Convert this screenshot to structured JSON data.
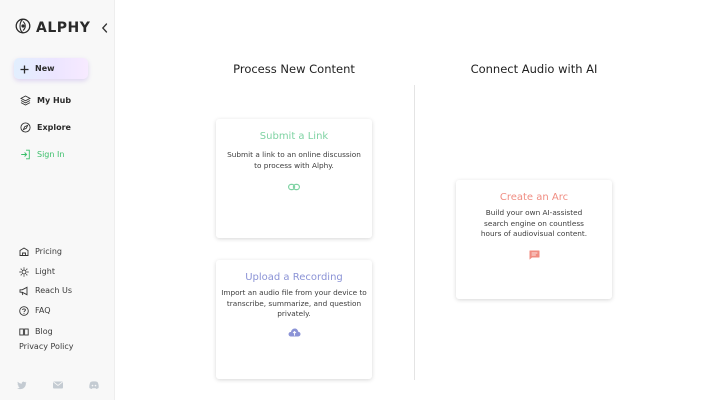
{
  "brand": {
    "name": "ALPHY"
  },
  "sidebar": {
    "new_label": "New",
    "nav": [
      {
        "label": "My Hub",
        "icon": "layers-icon"
      },
      {
        "label": "Explore",
        "icon": "compass-icon"
      },
      {
        "label": "Sign In",
        "icon": "sign-in-icon"
      }
    ],
    "bottom": [
      {
        "label": "Pricing",
        "icon": "pricing-icon"
      },
      {
        "label": "Light",
        "icon": "sun-icon"
      },
      {
        "label": "Reach Us",
        "icon": "megaphone-icon"
      },
      {
        "label": "FAQ",
        "icon": "help-icon"
      },
      {
        "label": "Blog",
        "icon": "blog-icon"
      }
    ],
    "privacy": "Privacy Policy",
    "socials": [
      "twitter-icon",
      "mail-icon",
      "discord-icon"
    ]
  },
  "main": {
    "process_title": "Process New Content",
    "connect_title": "Connect Audio with AI",
    "cards": {
      "link": {
        "title": "Submit a Link",
        "desc": "Submit a link to an online discussion to process with Alphy.",
        "icon": "link-icon"
      },
      "upload": {
        "title": "Upload a Recording",
        "desc": "Import an audio file from your device to transcribe, summarize, and question privately.",
        "icon": "cloud-upload-icon"
      },
      "arc": {
        "title": "Create an Arc",
        "desc": "Build your own AI-assisted search engine on countless hours of audiovisual content.",
        "icon": "chat-icon"
      }
    }
  },
  "colors": {
    "link_accent": "#7fd3a3",
    "upload_accent": "#8b93d6",
    "arc_accent": "#f08d82",
    "signin_accent": "#3bbf6a",
    "text_dark": "#222222"
  }
}
